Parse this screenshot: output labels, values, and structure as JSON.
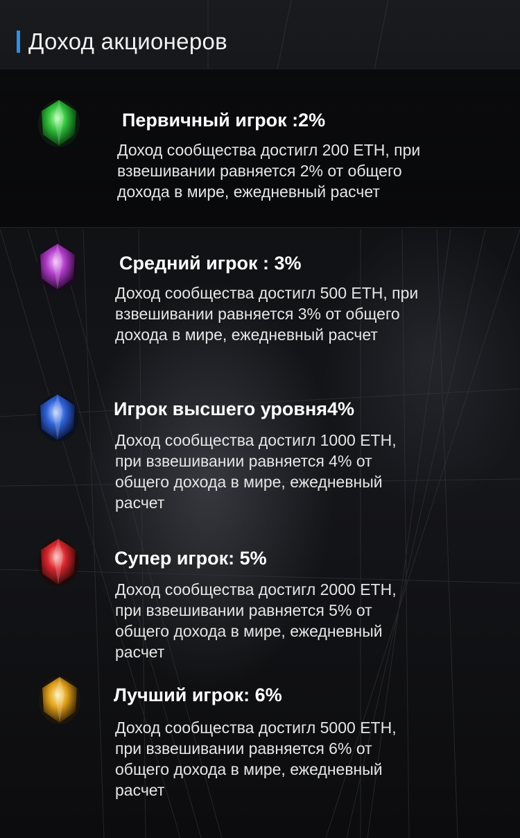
{
  "header": {
    "title": "Доход акционеров"
  },
  "tiers": [
    {
      "title": "Первичный игрок :2%",
      "lines": [
        "Доход сообщества достигл 200 ETH, при",
        "взвешивании равняется  2% от общего",
        "дохода в мире, ежедневный расчет"
      ],
      "gem_color": "#2fbf3a",
      "gem_icon": "green-gem-icon"
    },
    {
      "title": "Средний игрок : 3%",
      "lines": [
        "Доход сообщества достигл 500 ETH, при",
        "взвешивании равняется 3% от общего",
        "дохода в мире, ежедневный расчет"
      ],
      "gem_color": "#b03cc8",
      "gem_icon": "purple-gem-icon"
    },
    {
      "title": "Игрок высшего уровня4%",
      "lines": [
        "Доход сообщества достигл 1000 ETH,",
        "при взвешивании равняется 4% от",
        "общего дохода в мире, ежедневный",
        "расчет"
      ],
      "gem_color": "#2f62d8",
      "gem_icon": "blue-gem-icon"
    },
    {
      "title": "Супер игрок: 5%",
      "lines": [
        "Доход сообщества достигл 2000 ETH,",
        "при взвешивании равняется 5% от",
        "общего дохода в мире, ежедневный",
        "расчет"
      ],
      "gem_color": "#d8262c",
      "gem_icon": "red-gem-icon"
    },
    {
      "title": "Лучший игрок: 6%",
      "lines": [
        "Доход сообщества достигл 5000 ETH,",
        "при взвешивании равняется 6% от",
        "общего дохода в мире, ежедневный",
        "расчет"
      ],
      "gem_color": "#e0a01a",
      "gem_icon": "yellow-gem-icon"
    }
  ]
}
